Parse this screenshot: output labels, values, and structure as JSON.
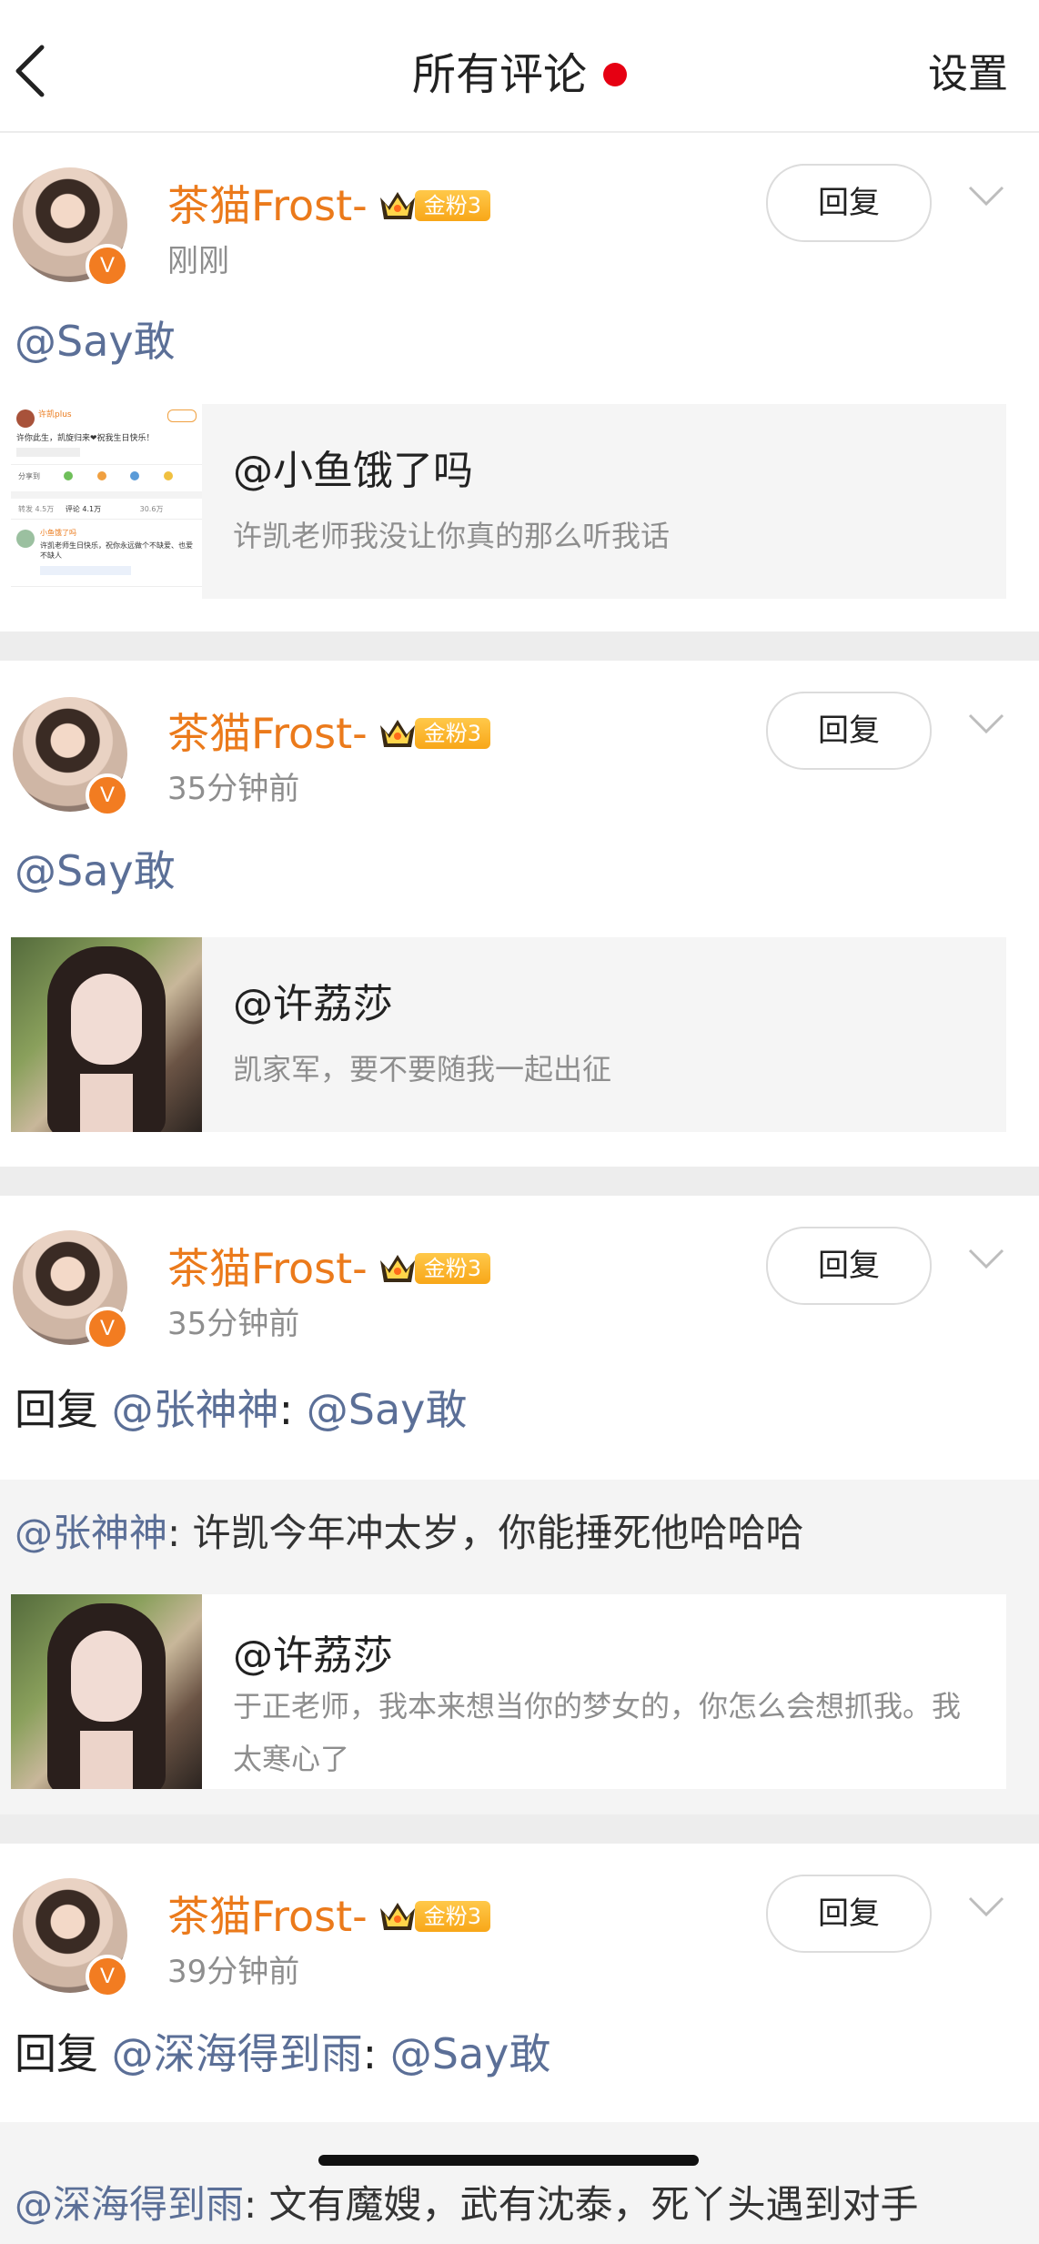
{
  "header": {
    "title": "所有评论",
    "settings_label": "设置"
  },
  "comments": [
    {
      "username": "茶猫Frost-",
      "fan_badge": "金粉3",
      "verified": "V",
      "time": "刚刚",
      "reply_label": "回复",
      "text_mention": "@Say敢",
      "quote": {
        "title": "@小鱼饿了吗",
        "subtitle": "许凯老师我没让你真的那么听我话",
        "thumb_type": "screenshot"
      }
    },
    {
      "username": "茶猫Frost-",
      "fan_badge": "金粉3",
      "verified": "V",
      "time": "35分钟前",
      "reply_label": "回复",
      "text_mention": "@Say敢",
      "quote": {
        "title": "@许荔莎",
        "subtitle": "凯家军，要不要随我一起出征",
        "thumb_type": "photo"
      }
    },
    {
      "username": "茶猫Frost-",
      "fan_badge": "金粉3",
      "verified": "V",
      "time": "35分钟前",
      "reply_label": "回复",
      "text_prefix": "回复 ",
      "text_reply_to": "@张神神",
      "text_colon": ": ",
      "text_mention": "@Say敢",
      "nested": {
        "mention": "@张神神",
        "text": ": 许凯今年冲太岁，你能捶死他哈哈哈"
      },
      "quote": {
        "title": "@许荔莎",
        "subtitle": "于正老师，我本来想当你的梦女的，你怎么会想抓我。我太寒心了",
        "thumb_type": "photo"
      }
    },
    {
      "username": "茶猫Frost-",
      "fan_badge": "金粉3",
      "verified": "V",
      "time": "39分钟前",
      "reply_label": "回复",
      "text_prefix": "回复 ",
      "text_reply_to": "@深海得到雨",
      "text_colon": ": ",
      "text_mention": "@Say敢",
      "nested": {
        "mention": "@深海得到雨",
        "text": ": 文有魔嫂，武有沈泰，死丫头遇到对手"
      }
    }
  ],
  "screenshot_thumb": {
    "user": "许凯plus",
    "line1": "许你此生，凯旋归来❤祝我生日快乐！",
    "repost": "转发 4.5万",
    "comments": "评论 4.1万",
    "likes": "30.6万",
    "commenter": "小鱼饿了吗",
    "comment": "许凯老师生日快乐，祝你永远做个不缺爱、也爱不缺人",
    "share": "分享到"
  },
  "colors": {
    "accent_orange": "#eb7a1b",
    "mention_blue": "#5b6f97",
    "notification_red": "#e60012",
    "badge_gold": "#f8a718"
  },
  "icons": [
    "chevron-left-icon",
    "chevron-down-icon",
    "crown-icon",
    "verified-icon"
  ]
}
